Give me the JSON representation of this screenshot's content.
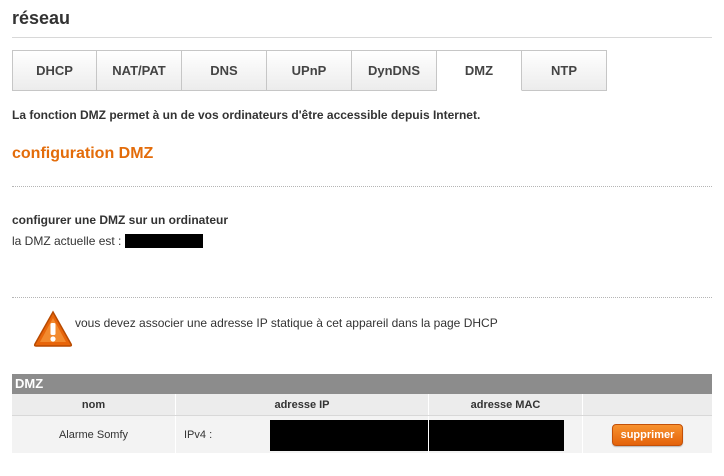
{
  "page": {
    "title": "réseau"
  },
  "tabs": [
    {
      "label": "DHCP",
      "active": false
    },
    {
      "label": "NAT/PAT",
      "active": false
    },
    {
      "label": "DNS",
      "active": false
    },
    {
      "label": "UPnP",
      "active": false
    },
    {
      "label": "DynDNS",
      "active": false
    },
    {
      "label": "DMZ",
      "active": true
    },
    {
      "label": "NTP",
      "active": false
    }
  ],
  "intro": "La fonction DMZ permet à un de vos ordinateurs d'être accessible depuis Internet.",
  "section": {
    "title": "configuration DMZ",
    "subhead": "configurer une DMZ sur un ordinateur",
    "current_label": "la DMZ actuelle est :"
  },
  "warning": {
    "icon": "warning-triangle-icon",
    "text": "vous devez associer une adresse IP statique à cet appareil dans la page DHCP"
  },
  "table": {
    "title": "DMZ",
    "columns": [
      "nom",
      "adresse IP",
      "adresse MAC",
      ""
    ],
    "rows": [
      {
        "name": "Alarme Somfy",
        "ip_prefix": "IPv4 :",
        "action": "supprimer"
      }
    ]
  },
  "colors": {
    "accent": "#e36c0a",
    "table_header": "#8c8c8c",
    "button": "#f07a1d"
  }
}
